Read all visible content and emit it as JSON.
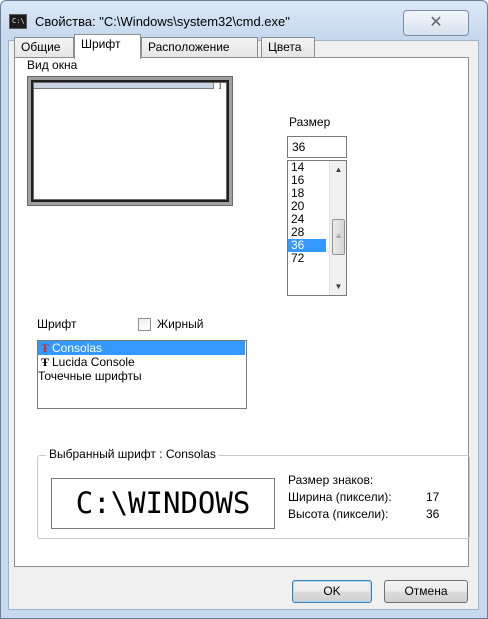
{
  "window": {
    "title": "Свойства: \"C:\\Windows\\system32\\cmd.exe\"",
    "app_icon_text": "C:\\",
    "close_symbol": "✕"
  },
  "tabs": [
    {
      "label": "Общие",
      "active": false
    },
    {
      "label": "Шрифт",
      "active": true
    },
    {
      "label": "Расположение",
      "active": false
    },
    {
      "label": "Цвета",
      "active": false
    }
  ],
  "window_preview": {
    "label": "Вид окна"
  },
  "size": {
    "label": "Размер",
    "value": "36",
    "options": [
      "14",
      "16",
      "18",
      "20",
      "24",
      "28",
      "36",
      "72"
    ],
    "selected": "36"
  },
  "font": {
    "label": "Шрифт",
    "bold_label": "Жирный",
    "bold_checked": false,
    "items": [
      {
        "name": "Consolas",
        "icon": "truetype-icon",
        "selected": true
      },
      {
        "name": "Lucida Console",
        "icon": "truetype-icon",
        "selected": false
      },
      {
        "name": "Точечные шрифты",
        "icon": "",
        "selected": false
      }
    ]
  },
  "selected_font": {
    "label": "Выбранный шрифт : Consolas",
    "sample": "C:\\WINDOWS",
    "char_size_label": "Размер знаков:",
    "width_label": "Ширина (пиксели):",
    "width_value": "17",
    "height_label": "Высота (пиксели):",
    "height_value": "36"
  },
  "buttons": {
    "ok": "OK",
    "cancel": "Отмена"
  },
  "colors": {
    "selection": "#3399ff",
    "chrome": "#c6d9ef"
  }
}
